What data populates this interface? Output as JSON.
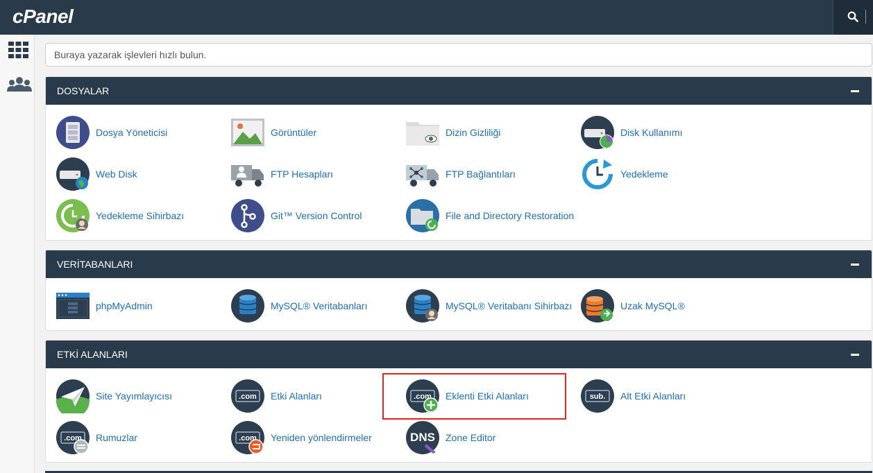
{
  "app": {
    "logo": "cPanel"
  },
  "search": {
    "placeholder": "Buraya yazarak işlevleri hızlı bulun."
  },
  "sections": {
    "files": {
      "title": "DOSYALAR",
      "items": [
        "Dosya Yöneticisi",
        "Görüntüler",
        "Dizin Gizliliği",
        "Disk Kullanımı",
        "Web Disk",
        "FTP Hesapları",
        "FTP Bağlantıları",
        "Yedekleme",
        "Yedekleme Sihirbazı",
        "Git™ Version Control",
        "File and Directory Restoration"
      ]
    },
    "databases": {
      "title": "VERİTABANLARI",
      "items": [
        "phpMyAdmin",
        "MySQL® Veritabanları",
        "MySQL® Veritabanı Sihirbazı",
        "Uzak MySQL®"
      ]
    },
    "domains": {
      "title": "ETKİ ALANLARI",
      "items": [
        "Site Yayımlayıcısı",
        "Etki Alanları",
        "Eklenti Etki Alanları",
        "Alt Etki Alanları",
        "Rumuzlar",
        "Yeniden yönlendirmeler",
        "Zone Editor"
      ]
    }
  },
  "icon_text": {
    "com": ".com",
    "sub": "sub.",
    "dns": "DNS"
  },
  "colors": {
    "header": "#293a4a",
    "link": "#1e6fb7",
    "highlight": "#e0251b",
    "icon_dark": "#2d3e50",
    "icon_blue": "#1e88e5",
    "icon_green": "#4caf50"
  }
}
